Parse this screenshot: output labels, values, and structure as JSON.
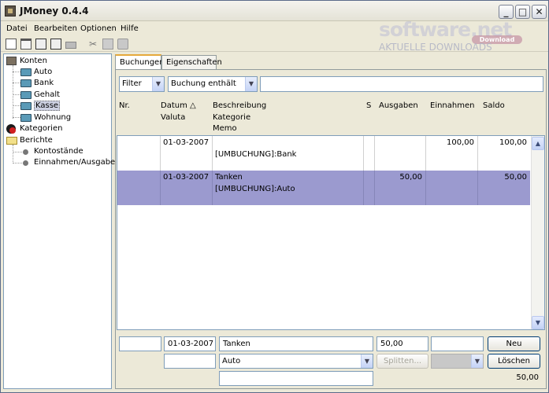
{
  "window": {
    "title": "JMoney 0.4.4"
  },
  "watermark": {
    "brand": "software.net",
    "tagline": "AKTUELLE DOWNLOADS",
    "badge": "Download"
  },
  "menu": [
    "Datei",
    "Bearbeiten",
    "Optionen",
    "Hilfe"
  ],
  "toolbar": [
    "new-file-icon",
    "open-icon",
    "save-icon",
    "save-as-icon",
    "print-icon",
    "cut-icon",
    "copy-icon",
    "paste-icon"
  ],
  "tree": {
    "konten": "Konten",
    "accounts": [
      "Auto",
      "Bank",
      "Gehalt",
      "Kasse",
      "Wohnung"
    ],
    "selected_account": "Kasse",
    "kategorien": "Kategorien",
    "berichte": "Berichte",
    "reports": [
      "Kontostände",
      "Einnahmen/Ausgaben"
    ]
  },
  "tabs": [
    "Buchungen",
    "Eigenschaften"
  ],
  "filter": {
    "filter_label": "Filter",
    "field_label": "Buchung enthält",
    "search_value": ""
  },
  "columns": {
    "nr": "Nr.",
    "datum": "Datum △",
    "valuta": "Valuta",
    "beschreibung": "Beschreibung",
    "kategorie": "Kategorie",
    "memo": "Memo",
    "s": "S",
    "ausgaben": "Ausgaben",
    "einnahmen": "Einnahmen",
    "saldo": "Saldo"
  },
  "rows": [
    {
      "nr": "",
      "datum": "01-03-2007",
      "beschreibung": "",
      "kategorie": "[UMBUCHUNG]:Bank",
      "s": "",
      "ausgaben": "",
      "einnahmen": "100,00",
      "saldo": "100,00"
    },
    {
      "nr": "",
      "datum": "01-03-2007",
      "beschreibung": "Tanken",
      "kategorie": "[UMBUCHUNG]:Auto",
      "s": "",
      "ausgaben": "50,00",
      "einnahmen": "",
      "saldo": "50,00"
    }
  ],
  "edit": {
    "nr": "",
    "datum": "01-03-2007",
    "beschreibung": "Tanken",
    "ausgaben": "50,00",
    "einnahmen": "",
    "valuta": "",
    "kategorie": "Auto",
    "splitten_label": "Splitten...",
    "status": "",
    "memo": "",
    "new_label": "Neu",
    "delete_label": "Löschen",
    "balance": "50,00"
  },
  "colors": {
    "selection": "#9b9acf",
    "window_bg": "#ece9d8",
    "tab_highlight": "#e5a83b"
  }
}
